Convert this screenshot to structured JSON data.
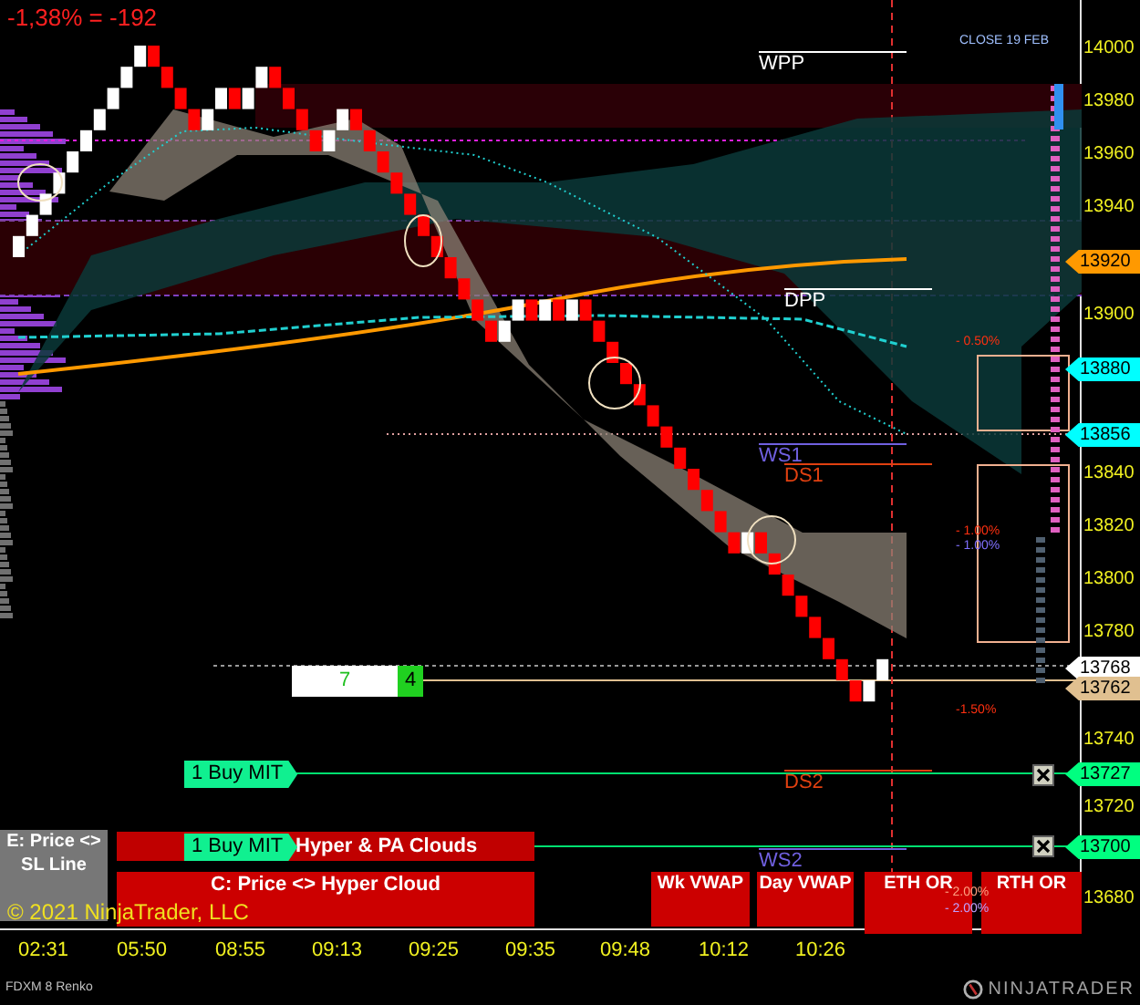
{
  "pnl": "-1,38% = -192",
  "close_label": "CLOSE 19 FEB",
  "levels": [
    {
      "label": "WPP",
      "color": "#ffffff"
    },
    {
      "label": "DPP",
      "color": "#ffffff"
    },
    {
      "label": "WS1",
      "color": "#7060e0"
    },
    {
      "label": "DS1",
      "color": "#e04010"
    },
    {
      "label": "DS2",
      "color": "#e04010"
    },
    {
      "label": "WS2",
      "color": "#7060e0"
    }
  ],
  "percent_labels": [
    {
      "text": "- 0.50%",
      "color": "#ff3010"
    },
    {
      "text": "- 1.00%",
      "color": "#ff3010"
    },
    {
      "text": "- 1.00%",
      "color": "#8070ff"
    },
    {
      "text": "-1.50%",
      "color": "#ff3010"
    },
    {
      "text": "- 2.00%",
      "color": "#ffa080"
    },
    {
      "text": "- 2.00%",
      "color": "#c0a0ff"
    }
  ],
  "position": {
    "quantity": "7",
    "count": "4"
  },
  "orders": [
    {
      "label": "1 Buy MIT"
    },
    {
      "label": "1 Buy MIT"
    }
  ],
  "panels": [
    {
      "label": "E: Price <> SL Line",
      "color": "#777777"
    },
    {
      "label": "Hyper & PA Clouds",
      "color": "#c00000"
    },
    {
      "label": "C: Price <> Hyper Cloud",
      "color": "#cc0000"
    },
    {
      "label": "Wk VWAP",
      "color": "#cc0000"
    },
    {
      "label": "Day VWAP",
      "color": "#cc0000"
    },
    {
      "label": "ETH OR",
      "color": "#cc0000"
    },
    {
      "label": "RTH OR",
      "color": "#cc0000"
    }
  ],
  "copyright": "© 2021 NinjaTrader, LLC",
  "price_ticks": [
    "14000",
    "13980",
    "13960",
    "13940",
    "13900",
    "13840",
    "13820",
    "13800",
    "13780",
    "13740",
    "13720",
    "13680"
  ],
  "price_markers": [
    {
      "text": "13920",
      "color": "#ff9900"
    },
    {
      "text": "13880",
      "color": "#00ffff"
    },
    {
      "text": "13856",
      "color": "#00ffff"
    },
    {
      "text": "13768",
      "color": "#ffffff"
    },
    {
      "text": "13762",
      "color": "#e0c090"
    },
    {
      "text": "13727",
      "color": "#00ff80"
    },
    {
      "text": "13700",
      "color": "#00ff80"
    }
  ],
  "time_ticks": [
    "02:31",
    "05:50",
    "08:55",
    "09:13",
    "09:25",
    "09:35",
    "09:48",
    "10:12",
    "10:26"
  ],
  "instrument": "FDXM 8 Renko",
  "logo": "NINJATRADER"
}
